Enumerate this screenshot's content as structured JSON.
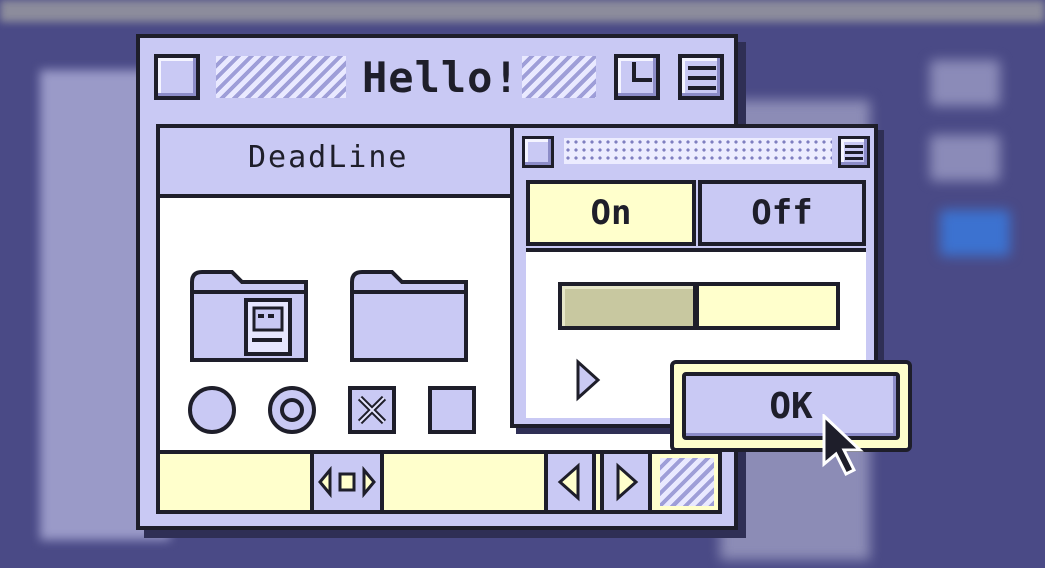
{
  "window": {
    "title": "Hello!",
    "panel_title": "DeadLine"
  },
  "icons": {
    "close_box": "close-box-icon",
    "zoom_box": "zoom-box-icon",
    "collapse_box": "collapse-box-icon",
    "folder_system": "system-folder-icon",
    "folder_plain": "folder-icon"
  },
  "controls": {
    "radio_unselected": "radio-unselected",
    "radio_selected": "radio-selected",
    "checkbox_checked": "checkbox-checked",
    "checkbox_unchecked": "checkbox-unchecked"
  },
  "toggle": {
    "on_label": "On",
    "off_label": "Off",
    "selected": "On"
  },
  "slider": {
    "progress": 0.5
  },
  "ok_button": {
    "label": "OK"
  },
  "colors": {
    "accent": "#c9c9f4",
    "highlight": "#ffffcc",
    "outline": "#1e1e2a",
    "desktop": "#4a4a86"
  }
}
